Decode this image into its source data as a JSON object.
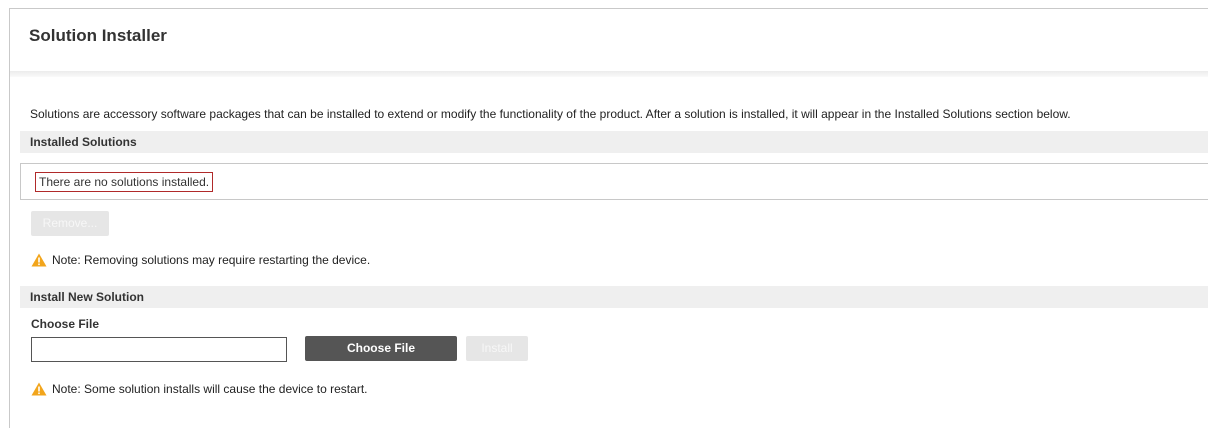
{
  "page": {
    "title": "Solution Installer",
    "intro": "Solutions are accessory software packages that can be installed to extend or modify the functionality of the product. After a solution is installed, it will appear in the Installed Solutions section below."
  },
  "installed": {
    "header": "Installed Solutions",
    "empty_message": "There are no solutions installed.",
    "remove_label": "Remove...",
    "note": "Note: Removing solutions may require restarting the device.",
    "note_icon": "warning-icon"
  },
  "install_new": {
    "header": "Install New Solution",
    "choose_file_label": "Choose File",
    "file_value": "",
    "choose_button_label": "Choose File",
    "install_label": "Install",
    "note": "Note: Some solution installs will cause the device to restart.",
    "note_icon": "warning-icon"
  },
  "colors": {
    "warning": "#f2a51c",
    "highlight_border": "#b02a2a",
    "primary_button": "#555555",
    "disabled_button": "#e6e6e6",
    "section_header_bg": "#efefef"
  }
}
